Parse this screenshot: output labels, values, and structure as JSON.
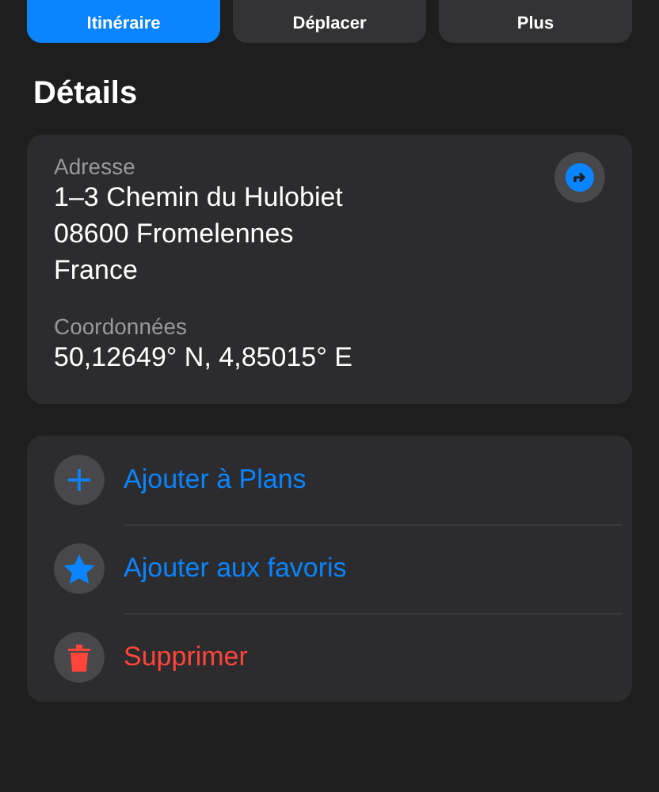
{
  "top_buttons": [
    {
      "label": "Itinéraire",
      "selected": true
    },
    {
      "label": "Déplacer",
      "selected": false
    },
    {
      "label": "Plus",
      "selected": false
    }
  ],
  "details": {
    "title": "Détails",
    "address": {
      "label": "Adresse",
      "lines": [
        "1–3 Chemin du Hulobiet",
        "08600 Fromelennes",
        "France"
      ]
    },
    "coordinates": {
      "label": "Coordonnées",
      "value": "50,12649° N, 4,85015° E"
    }
  },
  "actions": [
    {
      "kind": "add",
      "label": "Ajouter à Plans"
    },
    {
      "kind": "favorite",
      "label": "Ajouter aux favoris"
    },
    {
      "kind": "delete",
      "label": "Supprimer"
    }
  ]
}
